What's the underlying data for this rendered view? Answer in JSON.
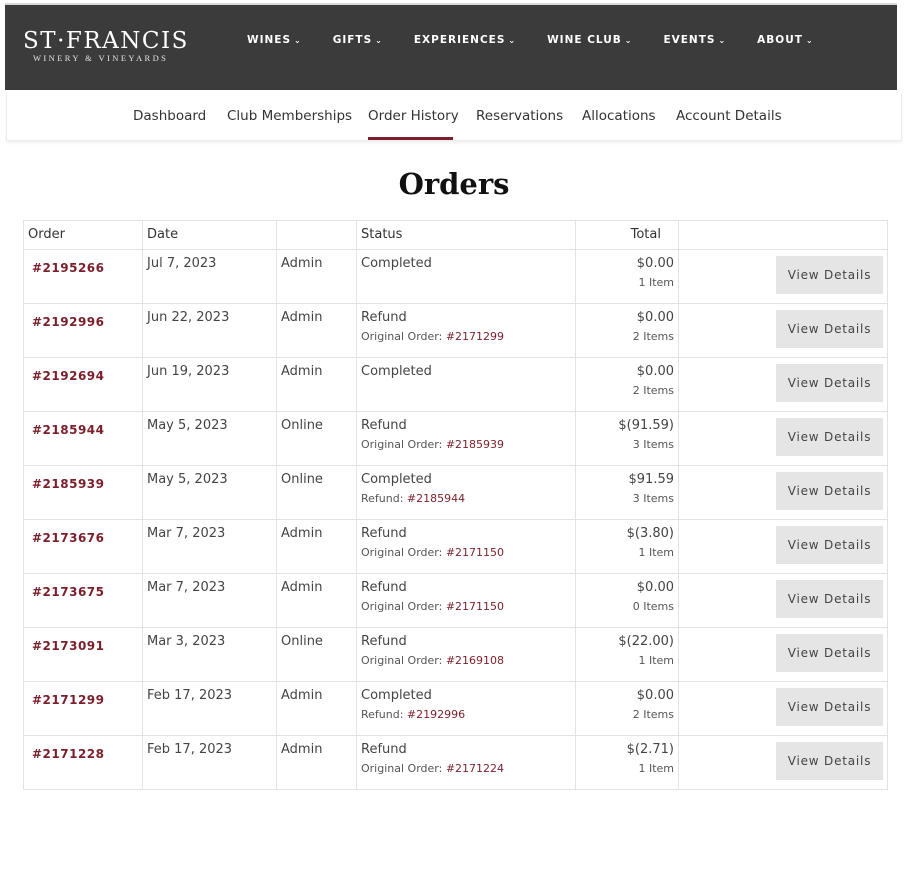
{
  "brand": {
    "name": "ST·FRANCIS",
    "tagline": "Winery & Vineyards"
  },
  "main_nav": [
    {
      "label": "WINES"
    },
    {
      "label": "GIFTS"
    },
    {
      "label": "EXPERIENCES"
    },
    {
      "label": "WINE CLUB"
    },
    {
      "label": "EVENTS"
    },
    {
      "label": "ABOUT"
    }
  ],
  "account_tabs": [
    {
      "label": "Dashboard",
      "active": false
    },
    {
      "label": "Club Memberships",
      "active": false
    },
    {
      "label": "Order History",
      "active": true
    },
    {
      "label": "Reservations",
      "active": false
    },
    {
      "label": "Allocations",
      "active": false
    },
    {
      "label": "Account Details",
      "active": false
    }
  ],
  "page": {
    "title": "Orders"
  },
  "table": {
    "headers": {
      "order": "Order",
      "date": "Date",
      "channel": "",
      "status": "Status",
      "total": "Total",
      "action": ""
    },
    "button_label": "View Details",
    "rows": [
      {
        "order": "#2195266",
        "date": "Jul 7, 2023",
        "channel": "Admin",
        "status": "Completed",
        "ref_label": "",
        "ref_order": "",
        "total": "$0.00",
        "items": "1 Item"
      },
      {
        "order": "#2192996",
        "date": "Jun 22, 2023",
        "channel": "Admin",
        "status": "Refund",
        "ref_label": "Original Order:",
        "ref_order": "#2171299",
        "total": "$0.00",
        "items": "2 Items"
      },
      {
        "order": "#2192694",
        "date": "Jun 19, 2023",
        "channel": "Admin",
        "status": "Completed",
        "ref_label": "",
        "ref_order": "",
        "total": "$0.00",
        "items": "2 Items"
      },
      {
        "order": "#2185944",
        "date": "May 5, 2023",
        "channel": "Online",
        "status": "Refund",
        "ref_label": "Original Order:",
        "ref_order": "#2185939",
        "total": "$(91.59)",
        "items": "3 Items"
      },
      {
        "order": "#2185939",
        "date": "May 5, 2023",
        "channel": "Online",
        "status": "Completed",
        "ref_label": "Refund:",
        "ref_order": "#2185944",
        "total": "$91.59",
        "items": "3 Items"
      },
      {
        "order": "#2173676",
        "date": "Mar 7, 2023",
        "channel": "Admin",
        "status": "Refund",
        "ref_label": "Original Order:",
        "ref_order": "#2171150",
        "total": "$(3.80)",
        "items": "1 Item"
      },
      {
        "order": "#2173675",
        "date": "Mar 7, 2023",
        "channel": "Admin",
        "status": "Refund",
        "ref_label": "Original Order:",
        "ref_order": "#2171150",
        "total": "$0.00",
        "items": "0 Items"
      },
      {
        "order": "#2173091",
        "date": "Mar 3, 2023",
        "channel": "Online",
        "status": "Refund",
        "ref_label": "Original Order:",
        "ref_order": "#2169108",
        "total": "$(22.00)",
        "items": "1 Item"
      },
      {
        "order": "#2171299",
        "date": "Feb 17, 2023",
        "channel": "Admin",
        "status": "Completed",
        "ref_label": "Refund:",
        "ref_order": "#2192996",
        "total": "$0.00",
        "items": "2 Items"
      },
      {
        "order": "#2171228",
        "date": "Feb 17, 2023",
        "channel": "Admin",
        "status": "Refund",
        "ref_label": "Original Order:",
        "ref_order": "#2171224",
        "total": "$(2.71)",
        "items": "1 Item"
      }
    ]
  },
  "colors": {
    "header_bg": "#3b3b3b",
    "accent": "#7a1f2b",
    "button_bg": "#e5e5e5"
  }
}
